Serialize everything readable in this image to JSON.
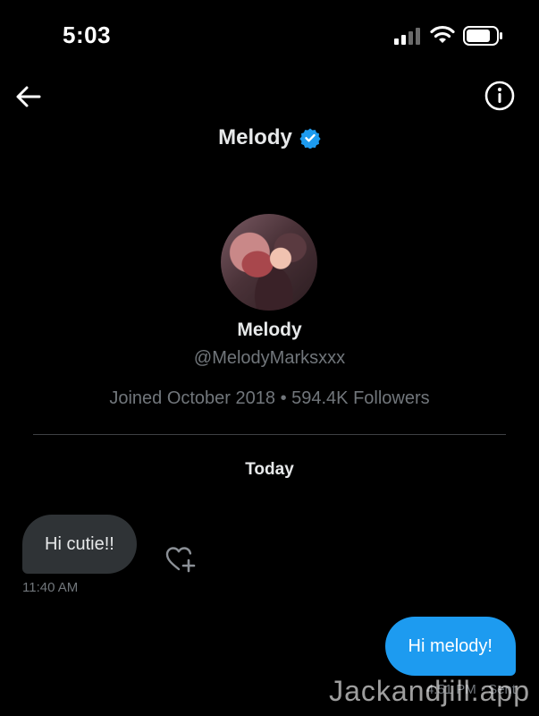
{
  "status_bar": {
    "time": "5:03",
    "icons": [
      "cellular-signal-icon",
      "wifi-icon",
      "battery-icon"
    ]
  },
  "header": {
    "title": "Melody",
    "back_icon": "back-arrow-icon",
    "info_icon": "info-icon",
    "verified_icon": "verified-badge-icon"
  },
  "profile": {
    "name": "Melody",
    "handle": "@MelodyMarksxxx",
    "meta": "Joined October 2018 • 594.4K Followers"
  },
  "conversation": {
    "day_label": "Today",
    "messages": [
      {
        "direction": "incoming",
        "text": "Hi cutie!!",
        "time": "11:40 AM"
      },
      {
        "direction": "outgoing",
        "text": "Hi melody!",
        "time": "4:51 PM · Sent"
      }
    ],
    "react_icon": "heart-plus-icon"
  },
  "watermark": "Jackandjill.app",
  "colors": {
    "background": "#000000",
    "accent": "#1d9bf0",
    "incoming_bubble": "#2f3336",
    "secondary_text": "#71767b"
  }
}
